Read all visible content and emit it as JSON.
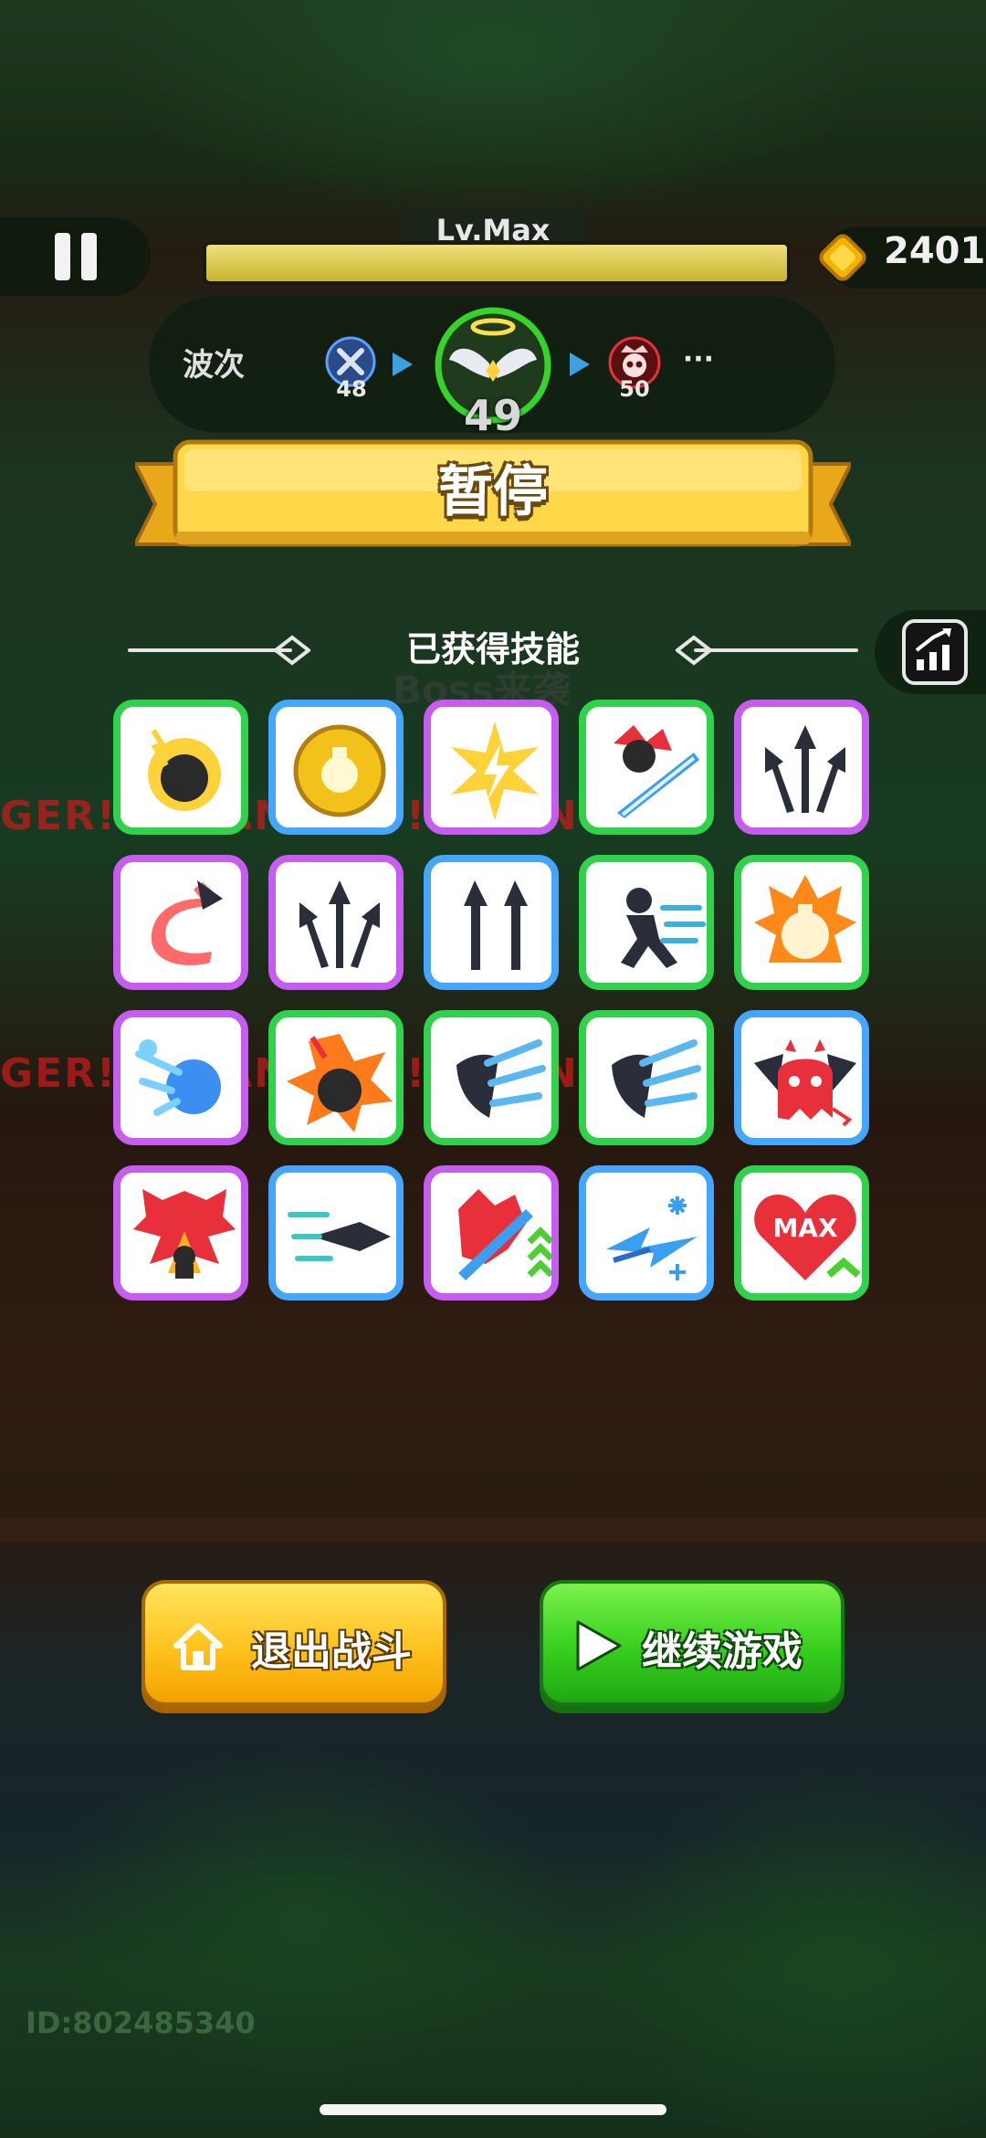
{
  "hud": {
    "level_label": "Lv.Max",
    "xp_progress": 1.0,
    "coins": "2401"
  },
  "wave": {
    "label": "波次",
    "previous": "48",
    "current": "49",
    "next": "50",
    "more": "···"
  },
  "pause_title": "暂停",
  "skills_section": {
    "title": "已获得技能",
    "background_text": "Boss来袭",
    "danger_text_1": "GER!! · DANGER!! · DANGER!! · DA",
    "danger_text_2": "GER!! · DANGER!! · DANGER!! · DA",
    "max_badge": "MAX"
  },
  "skills": [
    {
      "id": "thunder-bomb",
      "rarity": "green",
      "border": "#2fd24a"
    },
    {
      "id": "gold-potion-ball",
      "rarity": "blue",
      "border": "#45a6ff"
    },
    {
      "id": "lightning-burst",
      "rarity": "purple",
      "border": "#c65cf0"
    },
    {
      "id": "demon-blade-slash",
      "rarity": "green",
      "border": "#2fd24a"
    },
    {
      "id": "triple-arrow",
      "rarity": "purple",
      "border": "#c65cf0"
    },
    {
      "id": "curve-arrow",
      "rarity": "purple",
      "border": "#c65cf0"
    },
    {
      "id": "triple-arrow-b",
      "rarity": "purple",
      "border": "#c65cf0"
    },
    {
      "id": "double-arrow",
      "rarity": "blue",
      "border": "#45a6ff"
    },
    {
      "id": "dash-silhouette",
      "rarity": "green",
      "border": "#2fd24a"
    },
    {
      "id": "fire-potion",
      "rarity": "green",
      "border": "#2fd24a"
    },
    {
      "id": "ice-comet",
      "rarity": "purple",
      "border": "#c65cf0"
    },
    {
      "id": "fire-bomb-explosion",
      "rarity": "green",
      "border": "#2fd24a"
    },
    {
      "id": "wind-slash",
      "rarity": "green",
      "border": "#2fd24a"
    },
    {
      "id": "wind-slash-b",
      "rarity": "green",
      "border": "#2fd24a"
    },
    {
      "id": "devil-ghost",
      "rarity": "blue",
      "border": "#45a6ff"
    },
    {
      "id": "demon-summon",
      "rarity": "purple",
      "border": "#c65cf0"
    },
    {
      "id": "speed-arrow",
      "rarity": "blue",
      "border": "#45a6ff"
    },
    {
      "id": "blade-upgrade",
      "rarity": "purple",
      "border": "#c65cf0"
    },
    {
      "id": "frost-arrow",
      "rarity": "blue",
      "border": "#45a6ff"
    },
    {
      "id": "max-hp-heart",
      "rarity": "green",
      "border": "#2fd24a"
    }
  ],
  "buttons": {
    "exit": "退出战斗",
    "continue": "继续游戏"
  },
  "footer": {
    "user_id": "ID:802485340"
  }
}
